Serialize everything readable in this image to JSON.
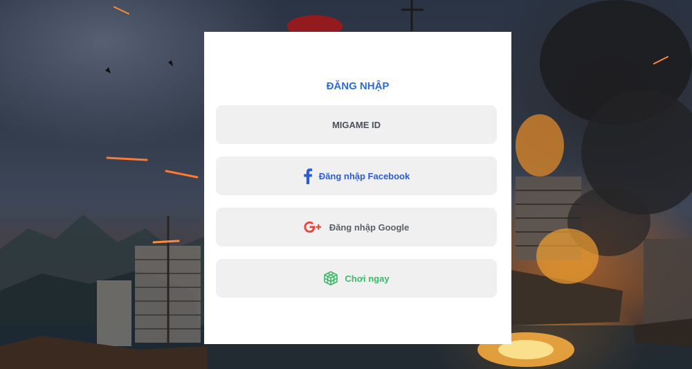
{
  "login": {
    "title": "ĐĂNG NHẬP",
    "buttons": {
      "migame": "MIGAME ID",
      "facebook": "Đăng nhập Facebook",
      "google": "Đăng nhập Google",
      "play_now": "Chơi ngay"
    }
  },
  "icons": {
    "facebook": "facebook-icon",
    "google": "google-plus-icon",
    "play_now": "cube-icon"
  },
  "colors": {
    "title": "#2d6bd8",
    "facebook": "#2d5bd1",
    "google_icon": "#e8453c",
    "google_text": "#5b5f66",
    "play_now": "#3fb86a",
    "button_bg": "#f0f0f0",
    "panel_bg": "#ffffff"
  }
}
